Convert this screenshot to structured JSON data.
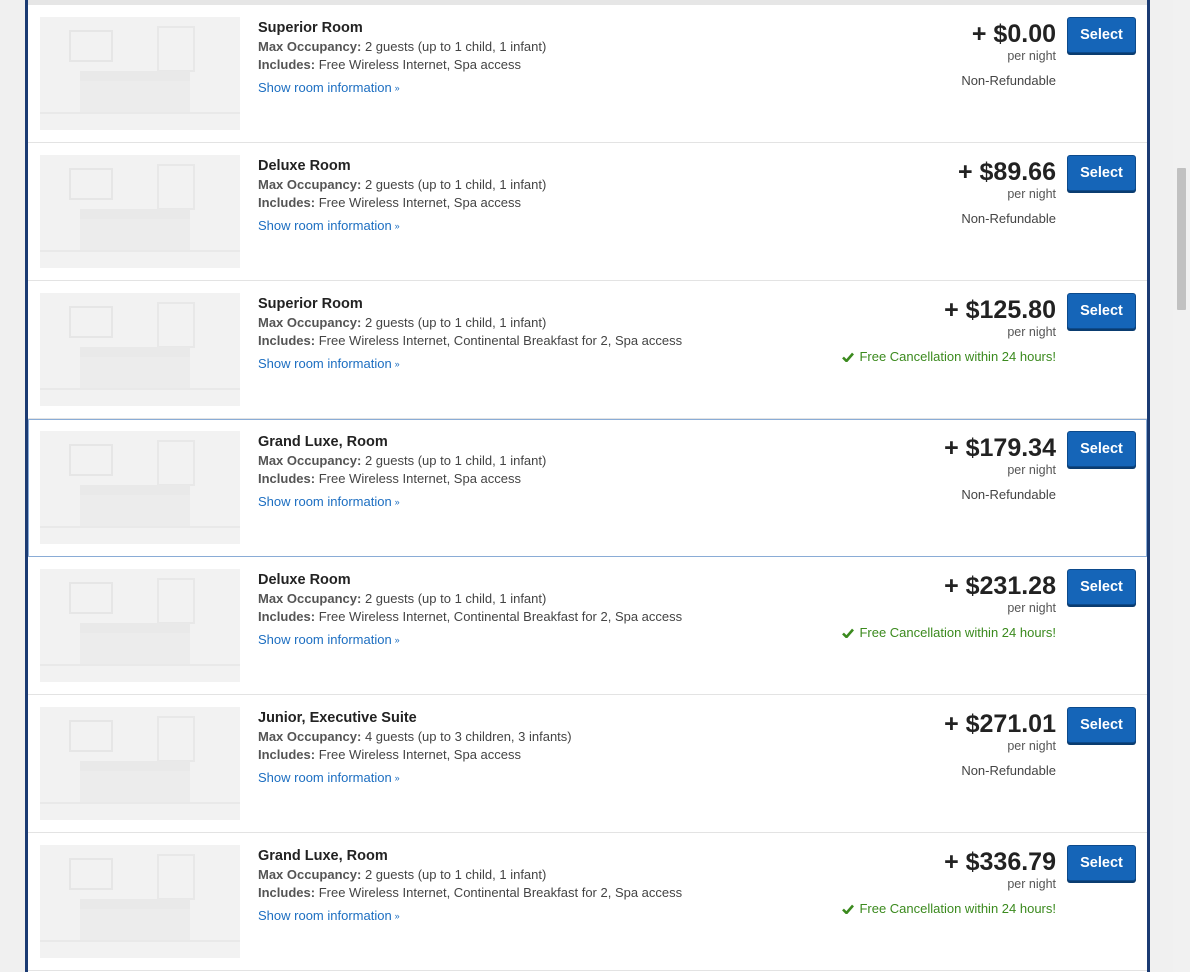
{
  "colors": {
    "accent": "#1565b8",
    "free_cancel": "#3b8a1e",
    "border": "#1b3b73"
  },
  "labels": {
    "max_occupancy": "Max Occupancy:",
    "includes": "Includes:",
    "show_room_info": "Show room information",
    "per_night": "per night",
    "select": "Select"
  },
  "rooms": [
    {
      "name": "Superior Room",
      "occupancy": "2 guests (up to 1 child, 1 infant)",
      "includes": "Free Wireless Internet, Spa access",
      "price": "+ $0.00",
      "policy": "Non-Refundable",
      "free_cancel": false
    },
    {
      "name": "Deluxe Room",
      "occupancy": "2 guests (up to 1 child, 1 infant)",
      "includes": "Free Wireless Internet, Spa access",
      "price": "+ $89.66",
      "policy": "Non-Refundable",
      "free_cancel": false
    },
    {
      "name": "Superior Room",
      "occupancy": "2 guests (up to 1 child, 1 infant)",
      "includes": "Free Wireless Internet, Continental Breakfast for 2, Spa access",
      "price": "+ $125.80",
      "policy": "Free Cancellation within 24 hours!",
      "free_cancel": true
    },
    {
      "name": "Grand Luxe, Room",
      "occupancy": "2 guests (up to 1 child, 1 infant)",
      "includes": "Free Wireless Internet, Spa access",
      "price": "+ $179.34",
      "policy": "Non-Refundable",
      "free_cancel": false
    },
    {
      "name": "Deluxe Room",
      "occupancy": "2 guests (up to 1 child, 1 infant)",
      "includes": "Free Wireless Internet, Continental Breakfast for 2, Spa access",
      "price": "+ $231.28",
      "policy": "Free Cancellation within 24 hours!",
      "free_cancel": true
    },
    {
      "name": "Junior, Executive Suite",
      "occupancy": "4 guests (up to 3 children, 3 infants)",
      "includes": "Free Wireless Internet, Spa access",
      "price": "+ $271.01",
      "policy": "Non-Refundable",
      "free_cancel": false
    },
    {
      "name": "Grand Luxe, Room",
      "occupancy": "2 guests (up to 1 child, 1 infant)",
      "includes": "Free Wireless Internet, Continental Breakfast for 2, Spa access",
      "price": "+ $336.79",
      "policy": "Free Cancellation within 24 hours!",
      "free_cancel": true
    }
  ]
}
